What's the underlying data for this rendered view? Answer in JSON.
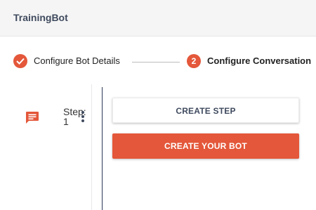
{
  "header": {
    "title": "TrainingBot"
  },
  "stepper": {
    "steps": [
      {
        "label": "Configure Bot Details",
        "status": "completed"
      },
      {
        "label": "Configure Conversation",
        "status": "active",
        "number": "2"
      }
    ]
  },
  "conversation": {
    "step_label": "Step: 1"
  },
  "actions": {
    "create_step": "CREATE STEP",
    "create_bot": "CREATE YOUR BOT"
  },
  "colors": {
    "accent": "#e4573a",
    "navy": "#3f4a5e",
    "timeline": "#2b3856"
  },
  "icons": {
    "completed_step": "check-icon",
    "step_item": "chat-bubble-icon",
    "step_menu": "more-vertical-icon"
  }
}
